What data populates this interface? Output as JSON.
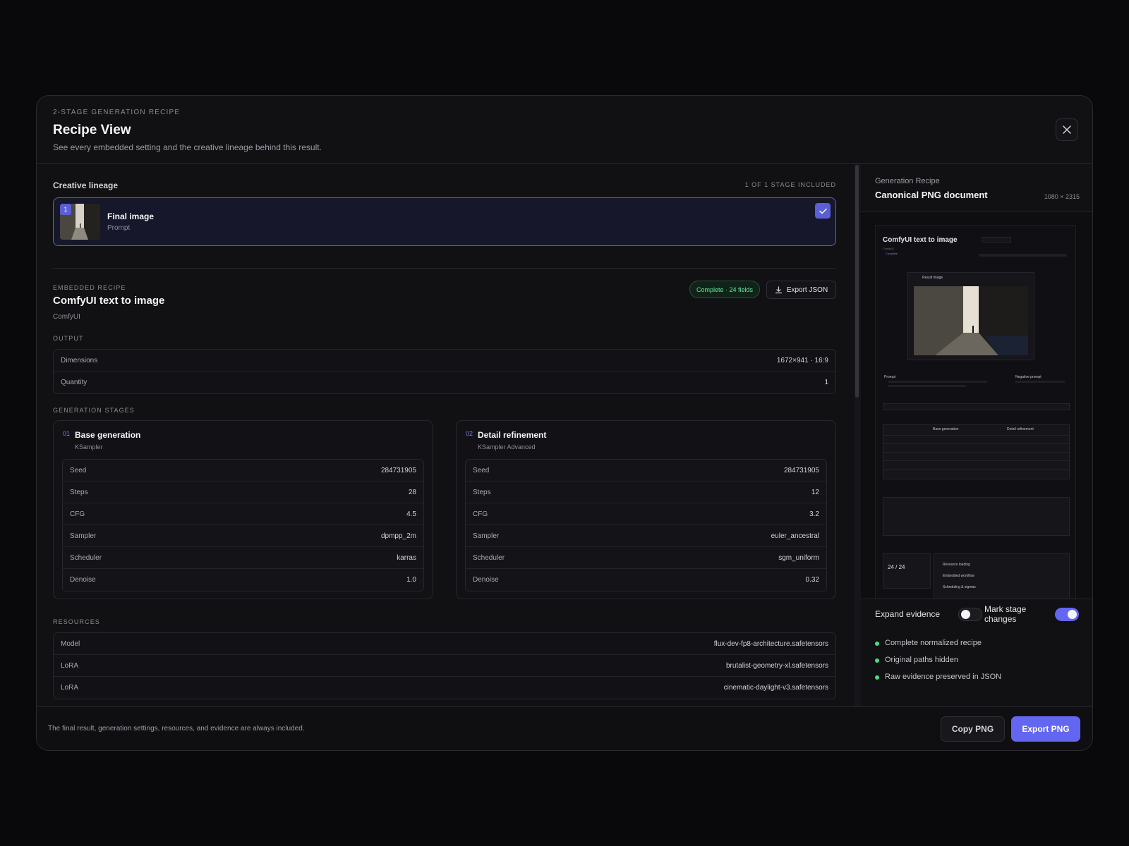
{
  "header": {
    "eyebrow": "2-STAGE GENERATION RECIPE",
    "title": "Recipe View",
    "subtitle": "See every embedded setting and the creative lineage behind this result."
  },
  "lineage": {
    "title": "Creative lineage",
    "count": "1 OF 1 STAGE INCLUDED",
    "item": {
      "number": "1",
      "name": "Final image",
      "sub": "Prompt"
    }
  },
  "recipe": {
    "eyebrow": "EMBEDDED RECIPE",
    "title": "ComfyUI text to image",
    "source": "ComfyUI",
    "status": "Complete · 24 fields",
    "export_label": "Export JSON"
  },
  "output": {
    "label": "OUTPUT",
    "rows": [
      {
        "k": "Dimensions",
        "v": "1672×941 · 16:9"
      },
      {
        "k": "Quantity",
        "v": "1"
      }
    ]
  },
  "stages": {
    "label": "GENERATION STAGES",
    "items": [
      {
        "num": "01",
        "title": "Base generation",
        "sub": "KSampler",
        "rows": [
          {
            "k": "Seed",
            "v": "284731905"
          },
          {
            "k": "Steps",
            "v": "28"
          },
          {
            "k": "CFG",
            "v": "4.5"
          },
          {
            "k": "Sampler",
            "v": "dpmpp_2m"
          },
          {
            "k": "Scheduler",
            "v": "karras"
          },
          {
            "k": "Denoise",
            "v": "1.0"
          }
        ]
      },
      {
        "num": "02",
        "title": "Detail refinement",
        "sub": "KSampler Advanced",
        "rows": [
          {
            "k": "Seed",
            "v": "284731905"
          },
          {
            "k": "Steps",
            "v": "12"
          },
          {
            "k": "CFG",
            "v": "3.2"
          },
          {
            "k": "Sampler",
            "v": "euler_ancestral"
          },
          {
            "k": "Scheduler",
            "v": "sgm_uniform"
          },
          {
            "k": "Denoise",
            "v": "0.32"
          }
        ]
      }
    ]
  },
  "resources": {
    "label": "RESOURCES",
    "rows": [
      {
        "k": "Model",
        "v": "flux-dev-fp8-architecture.safetensors"
      },
      {
        "k": "LoRA",
        "v": "brutalist-geometry-xl.safetensors"
      },
      {
        "k": "LoRA",
        "v": "cinematic-daylight-v3.safetensors"
      }
    ]
  },
  "panel": {
    "eyebrow": "Generation Recipe",
    "title": "Canonical PNG document",
    "dims": "1080 × 2315",
    "preview": {
      "title": "ComfyUI text to image",
      "sub": "ComfyUI",
      "status": "Complete",
      "result_label": "Result image",
      "stage_a": "Base generation",
      "stage_b": "Detail refinement",
      "prompt_label": "Prompt",
      "negative_label": "Negative prompt",
      "counter": "24 / 24",
      "ev1": "Resource loading",
      "ev2": "Embedded workflow",
      "ev3": "Scheduling & sigmas"
    },
    "toggles": {
      "expand_label": "Expand evidence",
      "expand_on": false,
      "mark_label_1": "Mark stage",
      "mark_label_2": "changes",
      "mark_on": true
    },
    "bullets": [
      "Complete normalized recipe",
      "Original paths hidden",
      "Raw evidence preserved in JSON"
    ]
  },
  "footer": {
    "note": "The final result, generation settings, resources, and evidence are always included.",
    "copy_label": "Copy PNG",
    "export_label": "Export PNG"
  },
  "colors": {
    "accent": "#6366f1",
    "success": "#4ade80",
    "background": "#09090b",
    "surface": "#111114"
  }
}
